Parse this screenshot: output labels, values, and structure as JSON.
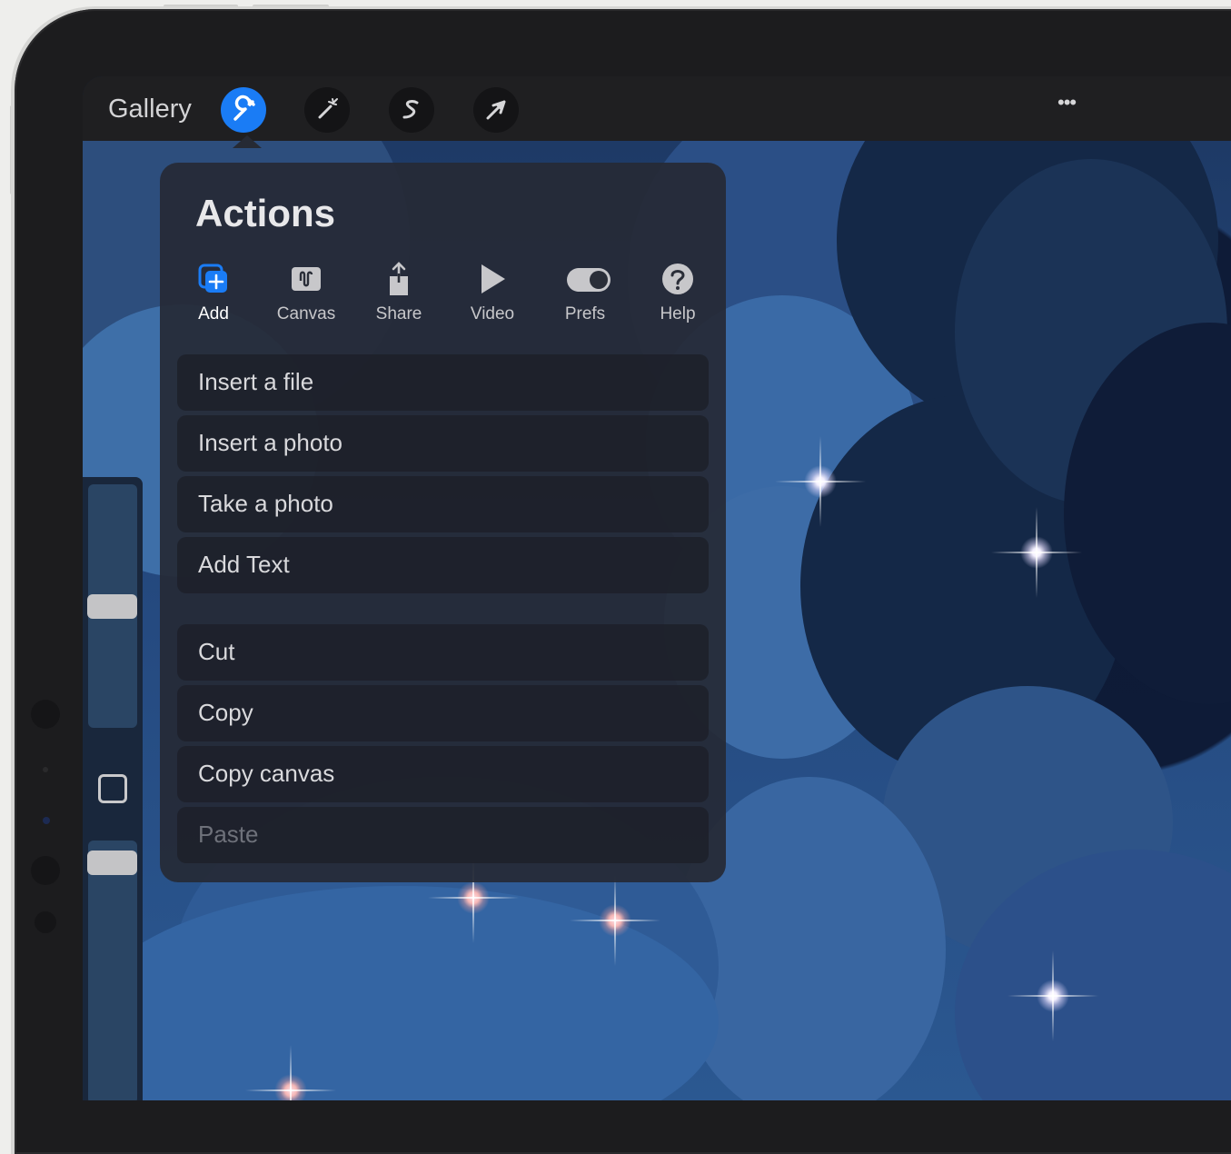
{
  "toolbar": {
    "gallery_label": "Gallery",
    "tools": [
      {
        "name": "actions",
        "icon": "wrench-icon",
        "active": true
      },
      {
        "name": "adjustments",
        "icon": "magic-wand-icon",
        "active": false
      },
      {
        "name": "selection",
        "icon": "selection-s-icon",
        "active": false
      },
      {
        "name": "transform",
        "icon": "arrow-cursor-icon",
        "active": false
      }
    ],
    "more_label": "•••",
    "accent": "#1a7cf5"
  },
  "actions_panel": {
    "title": "Actions",
    "tabs": [
      {
        "label": "Add",
        "icon": "add-layer-icon",
        "active": true
      },
      {
        "label": "Canvas",
        "icon": "canvas-icon",
        "active": false
      },
      {
        "label": "Share",
        "icon": "share-icon",
        "active": false
      },
      {
        "label": "Video",
        "icon": "play-icon",
        "active": false
      },
      {
        "label": "Prefs",
        "icon": "toggle-icon",
        "active": false
      },
      {
        "label": "Help",
        "icon": "help-icon",
        "active": false
      }
    ],
    "items_group1": [
      "Insert a file",
      "Insert a photo",
      "Take a photo",
      "Add Text"
    ],
    "items_group2": [
      "Cut",
      "Copy",
      "Copy canvas",
      "Paste"
    ],
    "disabled_items": [
      "Paste"
    ]
  },
  "side_panel": {
    "brush_size_icon": "brush-size-slider",
    "modify_icon": "square-modify-icon",
    "opacity_icon": "opacity-slider"
  }
}
